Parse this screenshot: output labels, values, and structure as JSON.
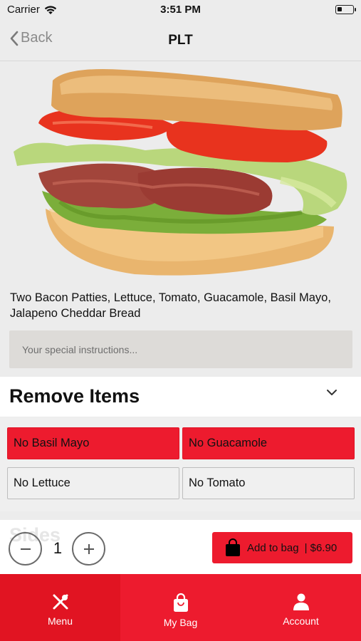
{
  "status_bar": {
    "carrier": "Carrier",
    "time": "3:51 PM"
  },
  "nav": {
    "back_label": "Back",
    "title": "PLT"
  },
  "item": {
    "description": "Two Bacon Patties, Lettuce, Tomato, Guacamole, Basil Mayo, Jalapeno Cheddar Bread",
    "instructions_placeholder": "Your special instructions..."
  },
  "remove_items": {
    "title": "Remove Items",
    "options": [
      {
        "label": "No Basil Mayo",
        "selected": true
      },
      {
        "label": "No Guacamole",
        "selected": true
      },
      {
        "label": "No Lettuce",
        "selected": false
      },
      {
        "label": "No Tomato",
        "selected": false
      }
    ]
  },
  "sides": {
    "title": "Sides"
  },
  "order": {
    "quantity": "1",
    "add_label": "Add to bag",
    "price": "| $6.90"
  },
  "tabs": [
    {
      "label": "Menu",
      "icon": "fork-knife-icon"
    },
    {
      "label": "My Bag",
      "icon": "bag-icon"
    },
    {
      "label": "Account",
      "icon": "person-icon"
    }
  ],
  "colors": {
    "accent": "#ed1b2e",
    "tab_active": "#e11422"
  }
}
